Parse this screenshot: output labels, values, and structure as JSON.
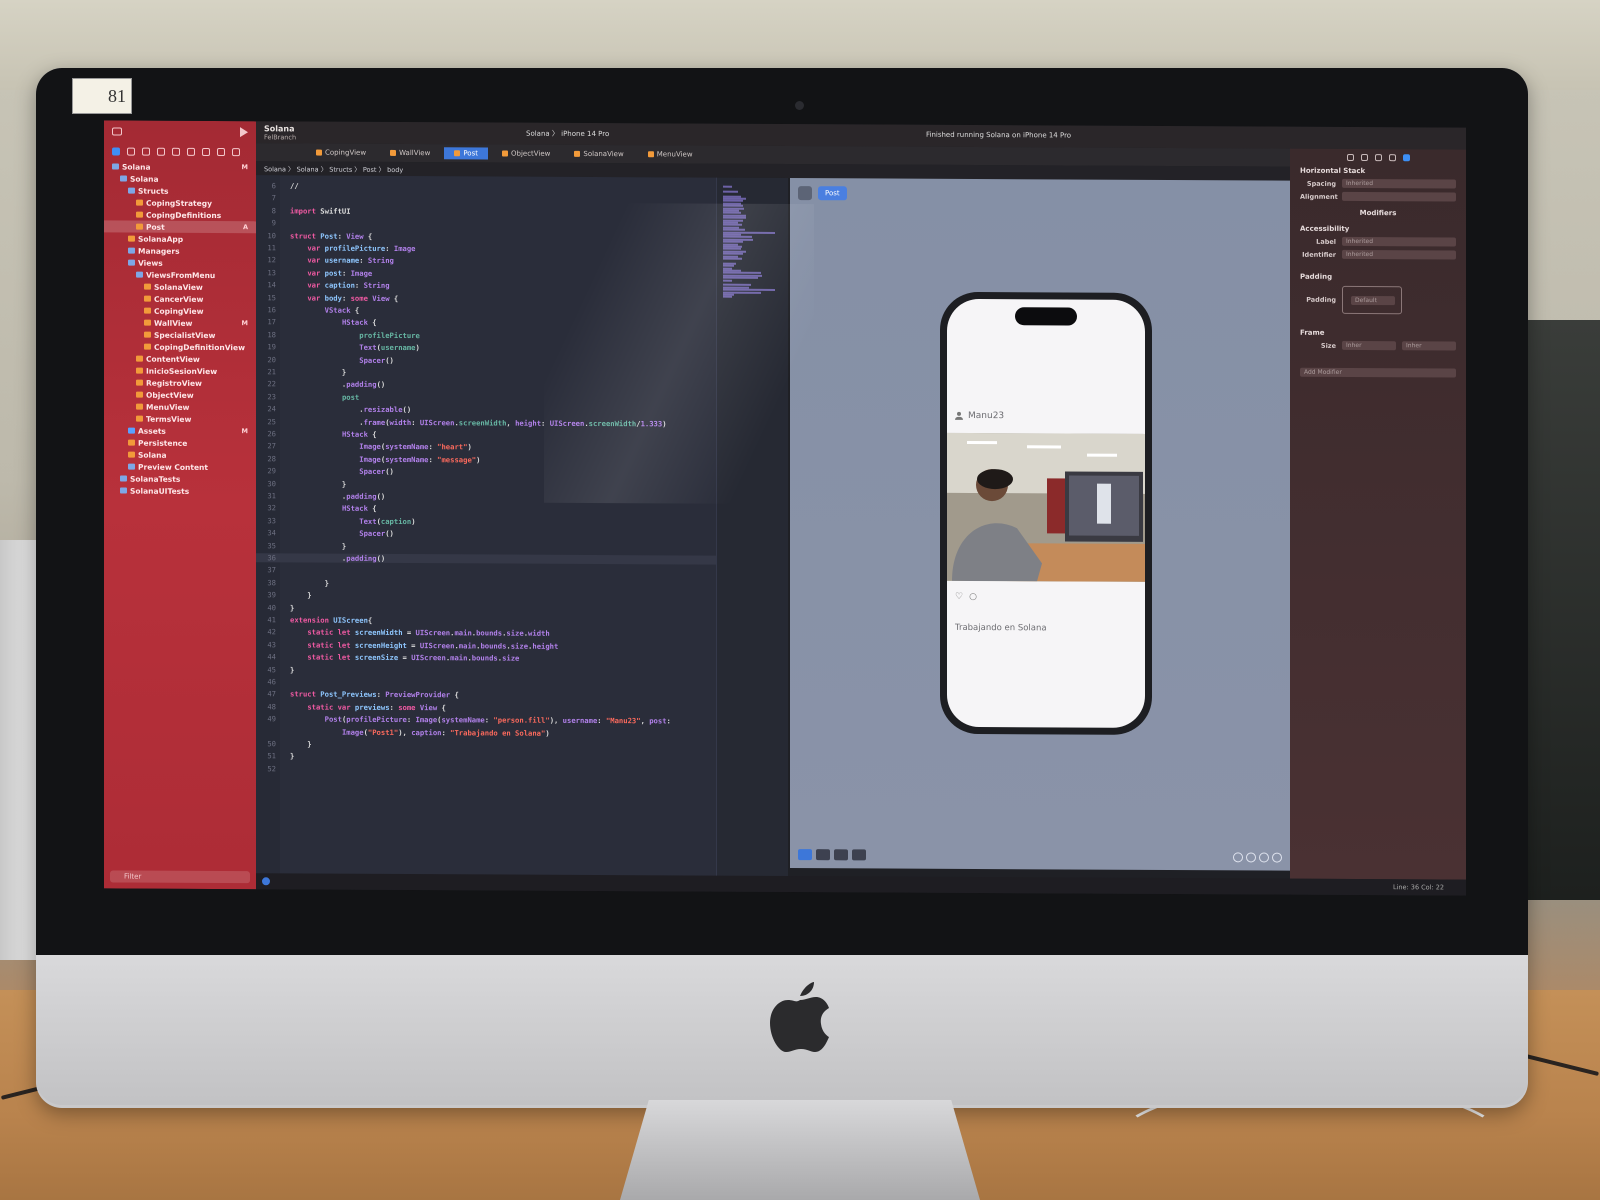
{
  "hardware": {
    "sticker_number": "81"
  },
  "navigator": {
    "items": [
      {
        "label": "Solana",
        "indent": 0,
        "kind": "folder",
        "badge": "M"
      },
      {
        "label": "Solana",
        "indent": 1,
        "kind": "folder",
        "badge": ""
      },
      {
        "label": "Structs",
        "indent": 2,
        "kind": "folder",
        "badge": ""
      },
      {
        "label": "CopingStrategy",
        "indent": 3,
        "kind": "swift",
        "badge": ""
      },
      {
        "label": "CopingDefinitions",
        "indent": 3,
        "kind": "swift",
        "badge": ""
      },
      {
        "label": "Post",
        "indent": 3,
        "kind": "swift",
        "badge": "A",
        "selected": true
      },
      {
        "label": "SolanaApp",
        "indent": 2,
        "kind": "swift",
        "badge": ""
      },
      {
        "label": "Managers",
        "indent": 2,
        "kind": "folder",
        "badge": ""
      },
      {
        "label": "Views",
        "indent": 2,
        "kind": "folder",
        "badge": ""
      },
      {
        "label": "ViewsFromMenu",
        "indent": 3,
        "kind": "folder",
        "badge": ""
      },
      {
        "label": "SolanaView",
        "indent": 4,
        "kind": "swift",
        "badge": ""
      },
      {
        "label": "CancerView",
        "indent": 4,
        "kind": "swift",
        "badge": ""
      },
      {
        "label": "CopingView",
        "indent": 4,
        "kind": "swift",
        "badge": ""
      },
      {
        "label": "WallView",
        "indent": 4,
        "kind": "swift",
        "badge": "M"
      },
      {
        "label": "SpecialistView",
        "indent": 4,
        "kind": "swift",
        "badge": ""
      },
      {
        "label": "CopingDefinitionView",
        "indent": 4,
        "kind": "swift",
        "badge": ""
      },
      {
        "label": "ContentView",
        "indent": 3,
        "kind": "swift",
        "badge": ""
      },
      {
        "label": "InicioSesionView",
        "indent": 3,
        "kind": "swift",
        "badge": ""
      },
      {
        "label": "RegistroView",
        "indent": 3,
        "kind": "swift",
        "badge": ""
      },
      {
        "label": "ObjectView",
        "indent": 3,
        "kind": "swift",
        "badge": ""
      },
      {
        "label": "MenuView",
        "indent": 3,
        "kind": "swift",
        "badge": ""
      },
      {
        "label": "TermsView",
        "indent": 3,
        "kind": "swift",
        "badge": ""
      },
      {
        "label": "Assets",
        "indent": 2,
        "kind": "asset",
        "badge": "M"
      },
      {
        "label": "Persistence",
        "indent": 2,
        "kind": "swift",
        "badge": ""
      },
      {
        "label": "Solana",
        "indent": 2,
        "kind": "swift",
        "badge": ""
      },
      {
        "label": "Preview Content",
        "indent": 2,
        "kind": "folder",
        "badge": ""
      },
      {
        "label": "SolanaTests",
        "indent": 1,
        "kind": "folder",
        "badge": ""
      },
      {
        "label": "SolanaUITests",
        "indent": 1,
        "kind": "folder",
        "badge": ""
      }
    ],
    "filter_placeholder": "Filter"
  },
  "titlebar": {
    "project": "Solana",
    "branch": "FelBranch",
    "scheme": "Solana 〉 iPhone 14 Pro",
    "status": "Finished running Solana on iPhone 14 Pro"
  },
  "tabs": [
    "CopingView",
    "WallView",
    "Post",
    "ObjectView",
    "SolanaView",
    "MenuView"
  ],
  "active_tab": "Post",
  "jumpbar": "Solana 〉 Solana 〉 Structs 〉 Post 〉 body",
  "code": [
    {
      "n": "6",
      "html": "//",
      "hl": false
    },
    {
      "n": "7",
      "html": "",
      "hl": false
    },
    {
      "n": "8",
      "html": "<span class='k'>import</span> SwiftUI",
      "hl": false
    },
    {
      "n": "9",
      "html": "",
      "hl": false
    },
    {
      "n": "10",
      "html": "<span class='k'>struct</span> <span class='t'>Post</span>: <span class='p'>View</span> {",
      "hl": false
    },
    {
      "n": "11",
      "html": "    <span class='k'>var</span> <span class='t'>profilePicture</span>: <span class='p'>Image</span>",
      "hl": false
    },
    {
      "n": "12",
      "html": "    <span class='k'>var</span> <span class='t'>username</span>: <span class='p'>String</span>",
      "hl": false
    },
    {
      "n": "13",
      "html": "    <span class='k'>var</span> <span class='t'>post</span>: <span class='p'>Image</span>",
      "hl": false
    },
    {
      "n": "14",
      "html": "    <span class='k'>var</span> <span class='t'>caption</span>: <span class='p'>String</span>",
      "hl": false
    },
    {
      "n": "15",
      "html": "    <span class='k'>var</span> <span class='t'>body</span>: <span class='k'>some</span> <span class='p'>View</span> {",
      "hl": false
    },
    {
      "n": "16",
      "html": "        <span class='p'>VStack</span> {",
      "hl": false
    },
    {
      "n": "17",
      "html": "            <span class='p'>HStack</span> {",
      "hl": false
    },
    {
      "n": "18",
      "html": "                <span class='f'>profilePicture</span>",
      "hl": false
    },
    {
      "n": "19",
      "html": "                <span class='p'>Text</span>(<span class='f'>username</span>)",
      "hl": false
    },
    {
      "n": "20",
      "html": "                <span class='p'>Spacer</span>()",
      "hl": false
    },
    {
      "n": "21",
      "html": "            }",
      "hl": false
    },
    {
      "n": "22",
      "html": "            .<span class='p'>padding</span>()",
      "hl": false
    },
    {
      "n": "23",
      "html": "            <span class='f'>post</span>",
      "hl": false
    },
    {
      "n": "24",
      "html": "                .<span class='p'>resizable</span>()",
      "hl": false
    },
    {
      "n": "25",
      "html": "                .<span class='p'>frame</span>(<span class='p'>width</span>: <span class='p'>UIScreen</span>.<span class='f'>screenWidth</span>, <span class='p'>height</span>: <span class='p'>UIScreen</span>.<span class='f'>screenWidth</span>/<span class='p'>1.333</span>)",
      "hl": false
    },
    {
      "n": "26",
      "html": "            <span class='p'>HStack</span> {",
      "hl": false
    },
    {
      "n": "27",
      "html": "                <span class='p'>Image</span>(<span class='p'>systemName</span>: <span class='s'>\"heart\"</span>)",
      "hl": false
    },
    {
      "n": "28",
      "html": "                <span class='p'>Image</span>(<span class='p'>systemName</span>: <span class='s'>\"message\"</span>)",
      "hl": false
    },
    {
      "n": "29",
      "html": "                <span class='p'>Spacer</span>()",
      "hl": false
    },
    {
      "n": "30",
      "html": "            }",
      "hl": false
    },
    {
      "n": "31",
      "html": "            .<span class='p'>padding</span>()",
      "hl": false
    },
    {
      "n": "32",
      "html": "            <span class='p'>HStack</span> {",
      "hl": false
    },
    {
      "n": "33",
      "html": "                <span class='p'>Text</span>(<span class='f'>caption</span>)",
      "hl": false
    },
    {
      "n": "34",
      "html": "                <span class='p'>Spacer</span>()",
      "hl": false
    },
    {
      "n": "35",
      "html": "            }",
      "hl": false
    },
    {
      "n": "36",
      "html": "            .<span class='p'>padding</span>()",
      "hl": true
    },
    {
      "n": "37",
      "html": "",
      "hl": false
    },
    {
      "n": "38",
      "html": "        }",
      "hl": false
    },
    {
      "n": "39",
      "html": "    }",
      "hl": false
    },
    {
      "n": "40",
      "html": "}",
      "hl": false
    },
    {
      "n": "41",
      "html": "<span class='k'>extension</span> <span class='t'>UIScreen</span>{",
      "hl": false
    },
    {
      "n": "42",
      "html": "    <span class='k'>static</span> <span class='k'>let</span> <span class='t'>screenWidth</span> = <span class='p'>UIScreen</span>.<span class='p'>main</span>.<span class='p'>bounds</span>.<span class='p'>size</span>.<span class='p'>width</span>",
      "hl": false
    },
    {
      "n": "43",
      "html": "    <span class='k'>static</span> <span class='k'>let</span> <span class='t'>screenHeight</span> = <span class='p'>UIScreen</span>.<span class='p'>main</span>.<span class='p'>bounds</span>.<span class='p'>size</span>.<span class='p'>height</span>",
      "hl": false
    },
    {
      "n": "44",
      "html": "    <span class='k'>static</span> <span class='k'>let</span> <span class='t'>screenSize</span> = <span class='p'>UIScreen</span>.<span class='p'>main</span>.<span class='p'>bounds</span>.<span class='p'>size</span>",
      "hl": false
    },
    {
      "n": "45",
      "html": "}",
      "hl": false
    },
    {
      "n": "46",
      "html": "",
      "hl": false
    },
    {
      "n": "47",
      "html": "<span class='k'>struct</span> <span class='t'>Post_Previews</span>: <span class='p'>PreviewProvider</span> {",
      "hl": false
    },
    {
      "n": "48",
      "html": "    <span class='k'>static</span> <span class='k'>var</span> <span class='t'>previews</span>: <span class='k'>some</span> <span class='p'>View</span> {",
      "hl": false
    },
    {
      "n": "49",
      "html": "        <span class='p'>Post</span>(<span class='p'>profilePicture</span>: <span class='p'>Image</span>(<span class='p'>systemName</span>: <span class='s'>\"person.fill\"</span>), <span class='p'>username</span>: <span class='s'>\"Manu23\"</span>, <span class='p'>post</span>:",
      "hl": false
    },
    {
      "n": "",
      "html": "            <span class='p'>Image</span>(<span class='s'>\"Post1\"</span>), <span class='p'>caption</span>: <span class='s'>\"Trabajando en Solana\"</span>)",
      "hl": false
    },
    {
      "n": "50",
      "html": "    }",
      "hl": false
    },
    {
      "n": "51",
      "html": "}",
      "hl": false
    },
    {
      "n": "52",
      "html": "",
      "hl": false
    }
  ],
  "preview": {
    "chip_label": "Post",
    "username": "Manu23",
    "caption": "Trabajando en Solana"
  },
  "inspector": {
    "title": "Horizontal Stack",
    "spacing_label": "Spacing",
    "spacing_value": "Inherited",
    "alignment_label": "Alignment",
    "modifiers_label": "Modifiers",
    "accessibility_label": "Accessibility",
    "label_label": "Label",
    "label_value": "Inherited",
    "identifier_label": "Identifier",
    "identifier_value": "Inherited",
    "padding_section": "Padding",
    "padding_label": "Padding",
    "padding_value": "Default",
    "frame_section": "Frame",
    "size_label": "Size",
    "width_value": "Inher",
    "height_value": "Inher",
    "add_modifier": "Add Modifier"
  },
  "statusbar": {
    "position": "Line: 36  Col: 22"
  }
}
